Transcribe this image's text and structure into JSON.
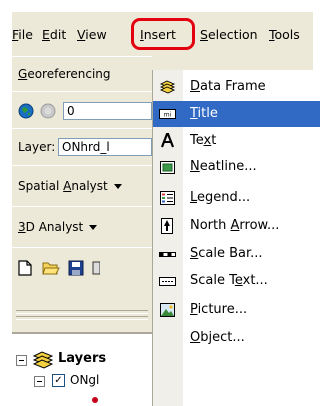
{
  "menubar": {
    "items": [
      {
        "pre": "",
        "u": "F",
        "post": "ile"
      },
      {
        "pre": "",
        "u": "E",
        "post": "dit"
      },
      {
        "pre": "",
        "u": "V",
        "post": "iew"
      },
      {
        "pre": "",
        "u": "I",
        "post": "nsert"
      },
      {
        "pre": "",
        "u": "S",
        "post": "election"
      },
      {
        "pre": "",
        "u": "T",
        "post": "ools"
      }
    ]
  },
  "toolbars": {
    "georef": {
      "u": "G",
      "post": "eoreferencing"
    },
    "effects": {
      "value": "0"
    },
    "layer": {
      "label": "Layer:",
      "value": "ONhrd_l"
    },
    "spatial": {
      "pre": "Spatial ",
      "u": "A",
      "post": "nalyst"
    },
    "analyst3d": {
      "u": "3",
      "post": "D Analyst"
    }
  },
  "toc": {
    "root": "Layers",
    "layer": "ONgl"
  },
  "dropdown": {
    "items": [
      {
        "pre": "",
        "u": "D",
        "post": "ata Frame",
        "icon": "data-frame-icon"
      },
      {
        "pre": "",
        "u": "T",
        "post": "itle",
        "icon": "title-icon"
      },
      {
        "pre": "Te",
        "u": "x",
        "post": "t",
        "icon": "text-icon"
      },
      {
        "pre": "",
        "u": "N",
        "post": "eatline...",
        "icon": "neatline-icon"
      },
      {
        "pre": "",
        "u": "L",
        "post": "egend...",
        "icon": "legend-icon"
      },
      {
        "pre": "North ",
        "u": "A",
        "post": "rrow...",
        "icon": "north-arrow-icon"
      },
      {
        "pre": "",
        "u": "S",
        "post": "cale Bar...",
        "icon": "scale-bar-icon"
      },
      {
        "pre": "Scale T",
        "u": "e",
        "post": "xt...",
        "icon": "scale-text-icon"
      },
      {
        "pre": "",
        "u": "P",
        "post": "icture...",
        "icon": "picture-icon"
      },
      {
        "pre": "",
        "u": "O",
        "post": "bject...",
        "icon": "object-icon"
      }
    ],
    "selected_index": 1
  },
  "colors": {
    "highlight": "#316ac5",
    "outline": "#e3000f",
    "face": "#ece9d8"
  }
}
